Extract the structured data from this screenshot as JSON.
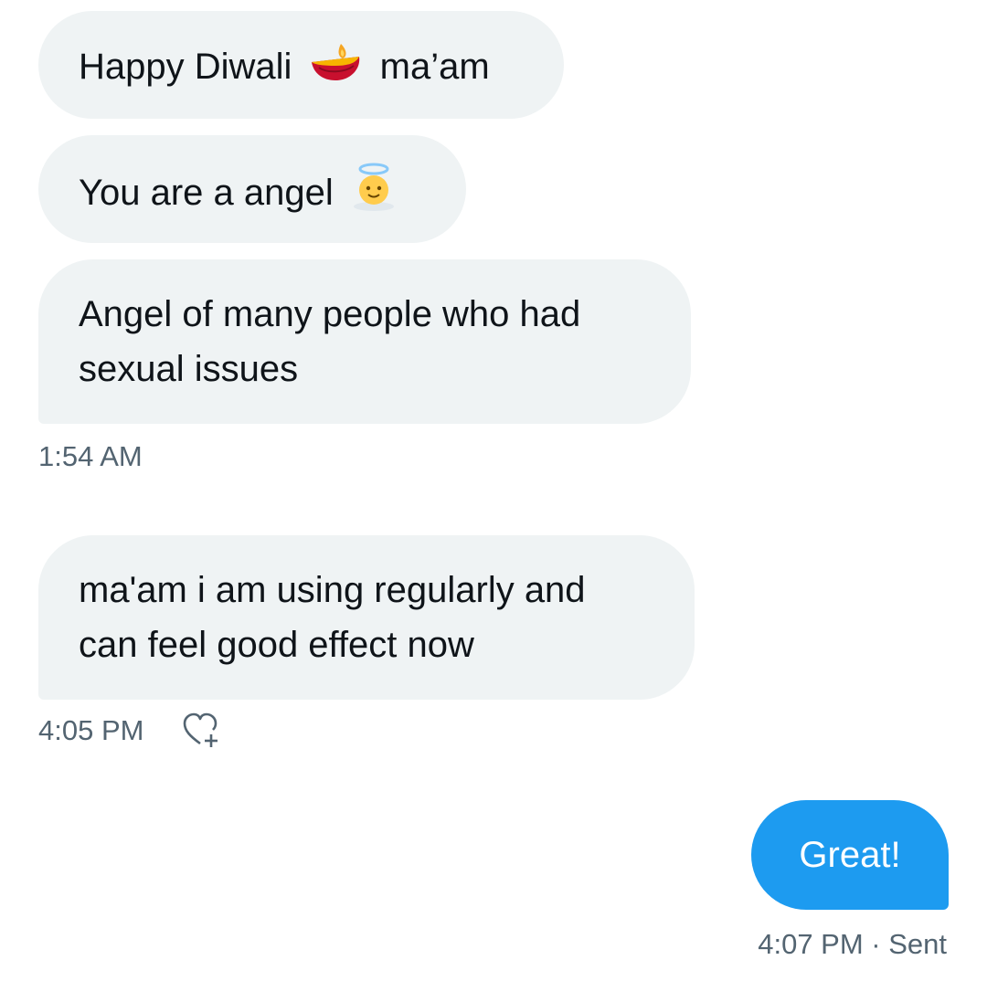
{
  "conversation": {
    "incoming": [
      {
        "before_emoji": "Happy Diwali",
        "emoji": "diya-lamp-icon",
        "after_emoji": "ma’am"
      },
      {
        "before_emoji": "You are a angel",
        "emoji": "angel-face-icon"
      },
      {
        "lines": [
          "Angel of many people who had",
          "sexual issues"
        ]
      }
    ],
    "incoming_time_1": "1:54 AM",
    "incoming_2": {
      "lines": [
        "ma'am i am using regularly and",
        "can feel good effect now"
      ]
    },
    "incoming_time_2": "4:05 PM",
    "outgoing": {
      "text": "Great!"
    },
    "outgoing_time": "4:07 PM · Sent"
  },
  "colors": {
    "incoming_bubble": "#eff3f4",
    "outgoing_bubble": "#1d9bf0",
    "meta_text": "#536471"
  },
  "icons": {
    "reaction": "heart-plus-icon"
  }
}
